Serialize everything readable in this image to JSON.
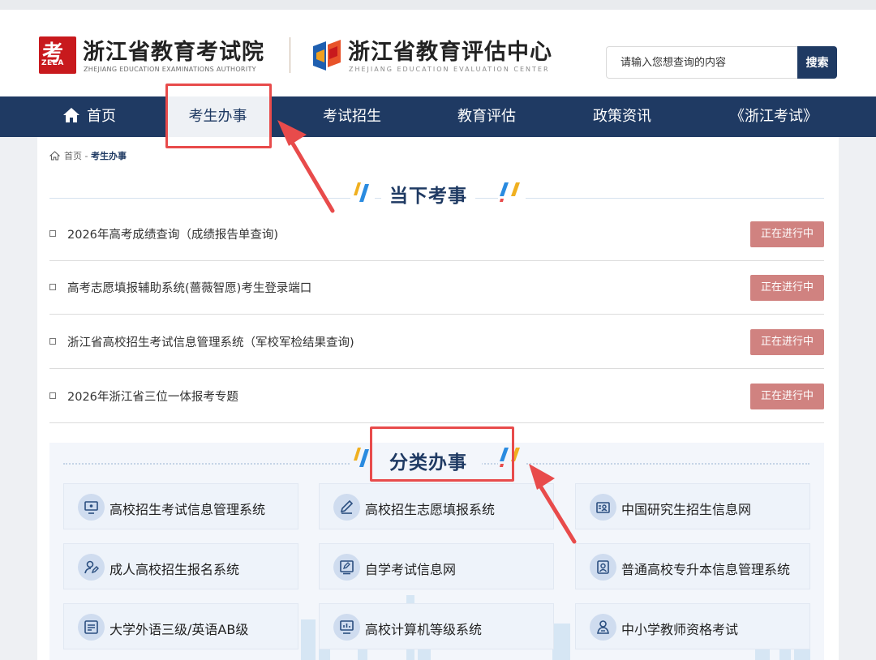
{
  "header": {
    "org1_name": "浙江省教育考试院",
    "org1_sub": "ZHEJIANG EDUCATION EXAMINATIONS AUTHORITY",
    "org1_logo_text": "ZEEA",
    "org2_name": "浙江省教育评估中心",
    "org2_sub": "ZHEJIANG EDUCATION EVALUATION CENTER",
    "search_placeholder": "请输入您想查询的内容",
    "search_button": "搜索"
  },
  "nav": {
    "items": [
      {
        "label": "首页",
        "icon": "home-icon"
      },
      {
        "label": "考生办事",
        "active": true
      },
      {
        "label": "考试招生"
      },
      {
        "label": "教育评估"
      },
      {
        "label": "政策资讯"
      },
      {
        "label": "《浙江考试》"
      }
    ]
  },
  "breadcrumb": {
    "home": "首页",
    "sep": " - ",
    "current": "考生办事"
  },
  "current_affairs": {
    "title": "当下考事",
    "items": [
      {
        "title": "2026年高考成绩查询（成绩报告单查询)",
        "status": "正在进行中"
      },
      {
        "title": "高考志愿填报辅助系统(蔷薇智愿)考生登录端口",
        "status": "正在进行中"
      },
      {
        "title": "浙江省高校招生考试信息管理系统（军校军检结果查询)",
        "status": "正在进行中"
      },
      {
        "title": "2026年浙江省三位一体报考专题",
        "status": "正在进行中"
      }
    ]
  },
  "services": {
    "title": "分类办事",
    "items": [
      {
        "label": "高校招生考试信息管理系统",
        "icon": "monitor-icon"
      },
      {
        "label": "高校招生志愿填报系统",
        "icon": "pen-icon"
      },
      {
        "label": "中国研究生招生信息网",
        "icon": "graduate-card-icon"
      },
      {
        "label": "成人高校招生报名系统",
        "icon": "user-edit-icon"
      },
      {
        "label": "自学考试信息网",
        "icon": "edit-screen-icon"
      },
      {
        "label": "普通高校专升本信息管理系统",
        "icon": "portrait-icon"
      },
      {
        "label": "大学外语三级/英语AB级",
        "icon": "document-icon"
      },
      {
        "label": "高校计算机等级系统",
        "icon": "computer-chart-icon"
      },
      {
        "label": "中小学教师资格考试",
        "icon": "teacher-icon"
      }
    ]
  },
  "colors": {
    "nav_bg": "#1f3a63",
    "status_bg": "#d08280",
    "highlight": "#e84b4b",
    "logo_red": "#c8191d"
  }
}
